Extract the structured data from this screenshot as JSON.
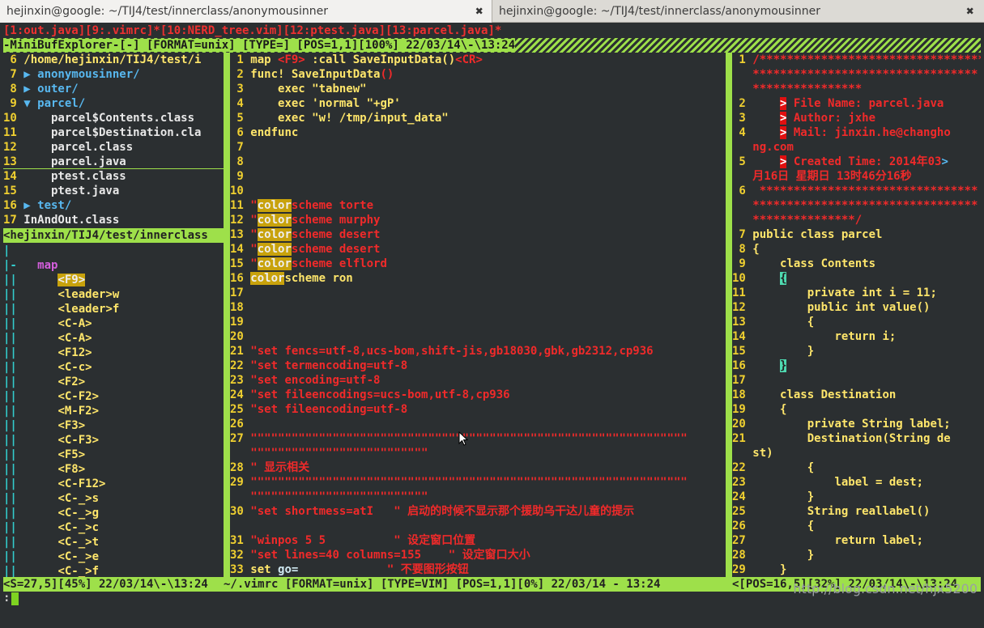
{
  "window_tabs": [
    {
      "title": "hejinxin@google: ~/TIJ4/test/innerclass/anonymousinner",
      "close": "✖"
    },
    {
      "title": "hejinxin@google: ~/TIJ4/test/innerclass/anonymousinner",
      "close": "✖"
    }
  ],
  "buffer_line": "[1:out.java][9:.vimrc]*[10:NERD_tree.vim][12:ptest.java][13:parcel.java]*",
  "minibuf_status": "-MiniBufExplorer-[-] [FORMAT=unix] [TYPE=] [POS=1,1][100%] 22/03/14\\-\\13:24",
  "nerdtree": {
    "lines": [
      {
        "n": "6",
        "text": " /home/hejinxin/TIJ4/test/i",
        "cls": "ye"
      },
      {
        "n": "7",
        "text": " ▶ anonymousinner/",
        "cls": "tree"
      },
      {
        "n": "8",
        "text": " ▶ outer/",
        "cls": "tree"
      },
      {
        "n": "9",
        "text": " ▼ parcel/",
        "cls": "tree"
      },
      {
        "n": "10",
        "text": "     parcel$Contents.class",
        "cls": "wt"
      },
      {
        "n": "11",
        "text": "     parcel$Destination.cla",
        "cls": "wt"
      },
      {
        "n": "12",
        "text": "     parcel.class",
        "cls": "wt"
      },
      {
        "n": "13",
        "text": "     parcel.java",
        "cls": "wt"
      },
      {
        "n": "14",
        "text": "     ptest.class",
        "cls": "wt"
      },
      {
        "n": "15",
        "text": "     ptest.java",
        "cls": "wt"
      },
      {
        "n": "16",
        "text": " ▶ test/",
        "cls": "tree"
      },
      {
        "n": "17",
        "text": " InAndOut.class",
        "cls": "wt"
      }
    ],
    "status": "<hejinxin/TIJ4/test/innerclass"
  },
  "maptree": {
    "lines": [
      {
        "pre": "|",
        "text": ""
      },
      {
        "pre": "|-",
        "text": "   map",
        "cls": "ma"
      },
      {
        "pre": "||",
        "text": "<F9>",
        "cls": "hl"
      },
      {
        "pre": "||",
        "text": "<leader>w"
      },
      {
        "pre": "||",
        "text": "<leader>f"
      },
      {
        "pre": "||",
        "text": "<C-A>"
      },
      {
        "pre": "||",
        "text": "<C-A>"
      },
      {
        "pre": "||",
        "text": "<F12>"
      },
      {
        "pre": "||",
        "text": "<C-c>"
      },
      {
        "pre": "||",
        "text": "<F2>"
      },
      {
        "pre": "||",
        "text": "<C-F2>"
      },
      {
        "pre": "||",
        "text": "<M-F2>"
      },
      {
        "pre": "||",
        "text": "<F3>"
      },
      {
        "pre": "||",
        "text": "<C-F3>"
      },
      {
        "pre": "||",
        "text": "<F5>"
      },
      {
        "pre": "||",
        "text": "<F8>"
      },
      {
        "pre": "||",
        "text": "<C-F12>"
      },
      {
        "pre": "||",
        "text": "<C-_>s"
      },
      {
        "pre": "||",
        "text": "<C-_>g"
      },
      {
        "pre": "||",
        "text": "<C-_>c"
      },
      {
        "pre": "||",
        "text": "<C-_>t"
      },
      {
        "pre": "||",
        "text": "<C-_>e"
      },
      {
        "pre": "||",
        "text": "<C-_>f"
      }
    ],
    "status": "<S=27,5][45%] 22/03/14\\-\\13:24"
  },
  "vimrc": {
    "lines": [
      {
        "n": "1",
        "parts": [
          {
            "t": "map ",
            "c": "ye"
          },
          {
            "t": "<F9>",
            "c": "red"
          },
          {
            "t": " :call SaveInputData()",
            "c": "ye"
          },
          {
            "t": "<CR>",
            "c": "red"
          }
        ]
      },
      {
        "n": "2",
        "parts": [
          {
            "t": "func! SaveInputData",
            "c": "ye"
          },
          {
            "t": "()",
            "c": "red"
          }
        ]
      },
      {
        "n": "3",
        "parts": [
          {
            "t": "    exec ",
            "c": "ye"
          },
          {
            "t": "\"tabnew\"",
            "c": "ye"
          }
        ]
      },
      {
        "n": "4",
        "parts": [
          {
            "t": "    exec ",
            "c": "ye"
          },
          {
            "t": "'normal \"+gP'",
            "c": "ye"
          }
        ]
      },
      {
        "n": "5",
        "parts": [
          {
            "t": "    exec ",
            "c": "ye"
          },
          {
            "t": "\"w! /tmp/input_data\"",
            "c": "ye"
          }
        ]
      },
      {
        "n": "6",
        "parts": [
          {
            "t": "endfunc",
            "c": "ye"
          }
        ]
      },
      {
        "n": "7",
        "parts": []
      },
      {
        "n": "8",
        "parts": []
      },
      {
        "n": "9",
        "parts": []
      },
      {
        "n": "10",
        "parts": []
      },
      {
        "n": "11",
        "parts": [
          {
            "t": "\"",
            "c": "red"
          },
          {
            "t": "color",
            "c": "hl"
          },
          {
            "t": "scheme torte",
            "c": "red"
          }
        ]
      },
      {
        "n": "12",
        "parts": [
          {
            "t": "\"",
            "c": "red"
          },
          {
            "t": "color",
            "c": "hl"
          },
          {
            "t": "scheme murphy",
            "c": "red"
          }
        ]
      },
      {
        "n": "13",
        "parts": [
          {
            "t": "\"",
            "c": "red"
          },
          {
            "t": "color",
            "c": "hl"
          },
          {
            "t": "scheme desert",
            "c": "red"
          }
        ]
      },
      {
        "n": "14",
        "parts": [
          {
            "t": "\"",
            "c": "red"
          },
          {
            "t": "color",
            "c": "hl"
          },
          {
            "t": "scheme desert",
            "c": "red"
          }
        ]
      },
      {
        "n": "15",
        "parts": [
          {
            "t": "\"",
            "c": "red"
          },
          {
            "t": "color",
            "c": "hl"
          },
          {
            "t": "scheme elflord",
            "c": "red"
          }
        ]
      },
      {
        "n": "16",
        "parts": [
          {
            "t": "color",
            "c": "hl"
          },
          {
            "t": "scheme ron",
            "c": "ye"
          }
        ]
      },
      {
        "n": "17",
        "parts": []
      },
      {
        "n": "18",
        "parts": []
      },
      {
        "n": "19",
        "parts": []
      },
      {
        "n": "20",
        "parts": []
      },
      {
        "n": "21",
        "parts": [
          {
            "t": "\"set fencs=utf-8,ucs-bom,shift-jis,gb18030,gbk,gb2312,cp936",
            "c": "red"
          }
        ]
      },
      {
        "n": "22",
        "parts": [
          {
            "t": "\"set termencoding=utf-8",
            "c": "red"
          }
        ]
      },
      {
        "n": "23",
        "parts": [
          {
            "t": "\"set encoding=utf-8",
            "c": "red"
          }
        ]
      },
      {
        "n": "24",
        "parts": [
          {
            "t": "\"set fileencodings=ucs-bom,utf-8,cp936",
            "c": "red"
          }
        ]
      },
      {
        "n": "25",
        "parts": [
          {
            "t": "\"set fileencoding=utf-8",
            "c": "red"
          }
        ]
      },
      {
        "n": "26",
        "parts": []
      },
      {
        "n": "27",
        "parts": [
          {
            "t": "\"\"\"\"\"\"\"\"\"\"\"\"\"\"\"\"\"\"\"\"\"\"\"\"\"\"\"\"\"\"\"\"\"\"\"\"\"\"\"\"\"\"\"\"\"\"\"\"\"\"\"\"\"\"\"\"\"\"\"\"\"\"\"\"",
            "c": "red"
          }
        ]
      },
      {
        "n": "",
        "parts": [
          {
            "t": "\"\"\"\"\"\"\"\"\"\"\"\"\"\"\"\"\"\"\"\"\"\"\"\"\"\"",
            "c": "red"
          }
        ]
      },
      {
        "n": "28",
        "parts": [
          {
            "t": "\" 显示相关",
            "c": "red"
          }
        ]
      },
      {
        "n": "29",
        "parts": [
          {
            "t": "\"\"\"\"\"\"\"\"\"\"\"\"\"\"\"\"\"\"\"\"\"\"\"\"\"\"\"\"\"\"\"\"\"\"\"\"\"\"\"\"\"\"\"\"\"\"\"\"\"\"\"\"\"\"\"\"\"\"\"\"\"\"\"\"",
            "c": "red"
          }
        ]
      },
      {
        "n": "",
        "parts": [
          {
            "t": "\"\"\"\"\"\"\"\"\"\"\"\"\"\"\"\"\"\"\"\"\"\"\"\"\"\"",
            "c": "red"
          }
        ]
      },
      {
        "n": "30",
        "parts": [
          {
            "t": "\"set shortmess=atI   \" 启动的时候不显示那个援助乌干达儿童的提示",
            "c": "red"
          }
        ]
      },
      {
        "n": "",
        "parts": []
      },
      {
        "n": "31",
        "parts": [
          {
            "t": "\"winpos 5 5          \" 设定窗口位置",
            "c": "red"
          }
        ]
      },
      {
        "n": "32",
        "parts": [
          {
            "t": "\"set lines=40 columns=155    \" 设定窗口大小",
            "c": "red"
          }
        ]
      },
      {
        "n": "33",
        "parts": [
          {
            "t": "set ",
            "c": "ye"
          },
          {
            "t": "go=",
            "c": "gr"
          },
          {
            "t": "             \" 不要图形按钮",
            "c": "red"
          }
        ]
      }
    ],
    "status": "~/.vimrc [FORMAT=unix] [TYPE=VIM] [POS=1,1][0%] 22/03/14 - 13:24"
  },
  "java": {
    "lines": [
      {
        "n": "1",
        "parts": [
          {
            "t": "/*********************************",
            "c": "red"
          }
        ]
      },
      {
        "n": "",
        "parts": [
          {
            "t": "*********************************",
            "c": "red"
          }
        ]
      },
      {
        "n": "",
        "parts": [
          {
            "t": "****************",
            "c": "red"
          }
        ]
      },
      {
        "n": "2",
        "parts": [
          {
            "t": "    ",
            "c": "red"
          },
          {
            "t": ">",
            "c": "marker"
          },
          {
            "t": " File Name: parcel.java",
            "c": "red"
          }
        ]
      },
      {
        "n": "3",
        "parts": [
          {
            "t": "    ",
            "c": "red"
          },
          {
            "t": ">",
            "c": "marker"
          },
          {
            "t": " Author: jxhe",
            "c": "red"
          }
        ]
      },
      {
        "n": "4",
        "parts": [
          {
            "t": "    ",
            "c": "red"
          },
          {
            "t": ">",
            "c": "marker"
          },
          {
            "t": " Mail: jinxin.he@changho",
            "c": "red"
          }
        ]
      },
      {
        "n": "",
        "parts": [
          {
            "t": "ng.com",
            "c": "red"
          }
        ]
      },
      {
        "n": "5",
        "parts": [
          {
            "t": "    ",
            "c": "red"
          },
          {
            "t": ">",
            "c": "marker"
          },
          {
            "t": " Created Time: 2014年03",
            "c": "red"
          },
          {
            "t": ">",
            "c": "tree"
          }
        ]
      },
      {
        "n": "",
        "parts": [
          {
            "t": "月16日 星期日 13时46分16秒",
            "c": "red"
          }
        ]
      },
      {
        "n": "6",
        "parts": [
          {
            "t": " ********************************",
            "c": "red"
          }
        ]
      },
      {
        "n": "",
        "parts": [
          {
            "t": "*********************************",
            "c": "red"
          }
        ]
      },
      {
        "n": "",
        "parts": [
          {
            "t": "***************/",
            "c": "red"
          }
        ]
      },
      {
        "n": "7",
        "parts": [
          {
            "t": "public class parcel",
            "c": "ye"
          }
        ]
      },
      {
        "n": "8",
        "parts": [
          {
            "t": "{",
            "c": "ye"
          }
        ]
      },
      {
        "n": "9",
        "parts": [
          {
            "t": "    class Contents",
            "c": "ye"
          }
        ]
      },
      {
        "n": "10",
        "parts": [
          {
            "t": "    ",
            "c": "ye"
          },
          {
            "t": "{",
            "c": "cur"
          }
        ]
      },
      {
        "n": "11",
        "parts": [
          {
            "t": "        private int i = 11;",
            "c": "ye"
          }
        ]
      },
      {
        "n": "12",
        "parts": [
          {
            "t": "        public int value()",
            "c": "ye"
          }
        ]
      },
      {
        "n": "13",
        "parts": [
          {
            "t": "        {",
            "c": "ye"
          }
        ]
      },
      {
        "n": "14",
        "parts": [
          {
            "t": "            return i;",
            "c": "ye"
          }
        ]
      },
      {
        "n": "15",
        "parts": [
          {
            "t": "        }",
            "c": "ye"
          }
        ]
      },
      {
        "n": "16",
        "parts": [
          {
            "t": "    ",
            "c": "ye"
          },
          {
            "t": "}",
            "c": "cur"
          }
        ]
      },
      {
        "n": "17",
        "parts": []
      },
      {
        "n": "18",
        "parts": [
          {
            "t": "    class Destination",
            "c": "ye"
          }
        ]
      },
      {
        "n": "19",
        "parts": [
          {
            "t": "    {",
            "c": "ye"
          }
        ]
      },
      {
        "n": "20",
        "parts": [
          {
            "t": "        private String label;",
            "c": "ye"
          }
        ]
      },
      {
        "n": "21",
        "parts": [
          {
            "t": "        Destination(String de",
            "c": "ye"
          }
        ]
      },
      {
        "n": "",
        "parts": [
          {
            "t": "st)",
            "c": "ye"
          }
        ]
      },
      {
        "n": "22",
        "parts": [
          {
            "t": "        {",
            "c": "ye"
          }
        ]
      },
      {
        "n": "23",
        "parts": [
          {
            "t": "            label = dest;",
            "c": "ye"
          }
        ]
      },
      {
        "n": "24",
        "parts": [
          {
            "t": "        }",
            "c": "ye"
          }
        ]
      },
      {
        "n": "25",
        "parts": [
          {
            "t": "        String reallabel()",
            "c": "ye"
          }
        ]
      },
      {
        "n": "26",
        "parts": [
          {
            "t": "        {",
            "c": "ye"
          }
        ]
      },
      {
        "n": "27",
        "parts": [
          {
            "t": "            return label;",
            "c": "ye"
          }
        ]
      },
      {
        "n": "28",
        "parts": [
          {
            "t": "        }",
            "c": "ye"
          }
        ]
      },
      {
        "n": "29",
        "parts": [
          {
            "t": "    }",
            "c": "ye"
          }
        ]
      }
    ],
    "status": "<[POS=16,5][32%] 22/03/14\\-\\13:24"
  },
  "cmdline": ":",
  "watermark": "http://blog.csdn.net/hjx5200"
}
